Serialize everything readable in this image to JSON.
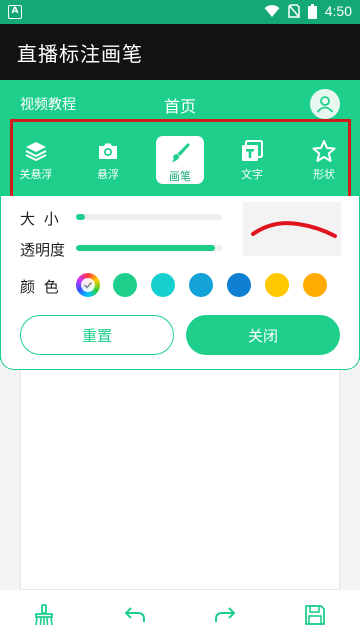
{
  "statusbar": {
    "time": "4:50",
    "app_letter": "A"
  },
  "appbar": {
    "title": "直播标注画笔"
  },
  "topnav": {
    "tutorial": "视频教程",
    "home": "首页"
  },
  "tools": [
    {
      "label": "关悬浮",
      "icon": "layers-icon"
    },
    {
      "label": "悬浮",
      "icon": "camera-icon"
    },
    {
      "label": "画笔",
      "icon": "brush-icon",
      "active": true
    },
    {
      "label": "文字",
      "icon": "text-icon"
    },
    {
      "label": "形状",
      "icon": "star-icon"
    }
  ],
  "settings": {
    "size_label": "大 小",
    "size_value": 0.06,
    "opacity_label": "透明度",
    "opacity_value": 0.95,
    "color_label": "颜 色",
    "colors": [
      "#1ecf8c",
      "#16d0d0",
      "#13a3d8",
      "#0f7fd3",
      "#ffc800",
      "#ffab00"
    ]
  },
  "buttons": {
    "reset": "重置",
    "close": "关闭"
  },
  "theme": {
    "accent": "#1ecf8c",
    "stroke": "#e0141e"
  }
}
